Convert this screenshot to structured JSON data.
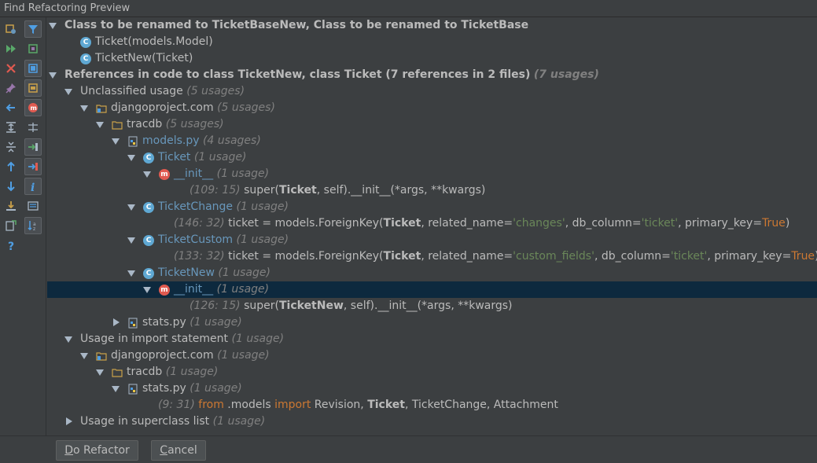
{
  "window": {
    "title": "Find Refactoring Preview"
  },
  "toolbar_left": [
    "rerun-icon",
    "run-icon",
    "close-icon",
    "pin-icon",
    "back-icon",
    "expand-all-icon",
    "collapse-all-icon",
    "up-icon",
    "down-icon",
    "export-icon",
    "open-in-new-icon",
    "help-icon"
  ],
  "toolbar_right": [
    "filter-icon",
    "settings-icon",
    "group-by-module-icon",
    "group-by-package-icon",
    "method-icon",
    "merge-icon",
    "import-icon",
    "usage-icon",
    "info-icon",
    "preview-icon",
    "sort-icon"
  ],
  "tree": {
    "header1": "Class to be renamed to TicketBaseNew, Class to be renamed to TicketBase",
    "class1": "Ticket(models.Model)",
    "class2": "TicketNew(Ticket)",
    "header2": "References in code to class TicketNew, class Ticket (7 references in 2 files)",
    "header2_count": "(7 usages)",
    "unclassified": "Unclassified usage",
    "unclassified_count": "(5 usages)",
    "project1": "djangoproject.com",
    "project1_count": "(5 usages)",
    "tracdb1": "tracdb",
    "tracdb1_count": "(5 usages)",
    "models_py": "models.py",
    "models_py_count": "(4 usages)",
    "ticket_cls": "Ticket",
    "ticket_cls_count": "(1 usage)",
    "init1": "__init__",
    "init1_count": "(1 usage)",
    "line1_pos": "(109: 15)",
    "line1_a": "super(",
    "line1_b": "Ticket",
    "line1_c": ", self).__init__(*args, **kwargs)",
    "ticketchange": "TicketChange",
    "ticketchange_count": "(1 usage)",
    "line2_pos": "(146: 32)",
    "line2_a": "ticket = models.ForeignKey(",
    "line2_b": "Ticket",
    "line2_c": ", related_name=",
    "line2_d": "'changes'",
    "line2_e": ", db_column=",
    "line2_f": "'ticket'",
    "line2_g": ", primary_key=",
    "line2_h": "True",
    "line2_i": ")",
    "ticketcustom": "TicketCustom",
    "ticketcustom_count": "(1 usage)",
    "line3_pos": "(133: 32)",
    "line3_a": "ticket = models.ForeignKey(",
    "line3_b": "Ticket",
    "line3_c": ", related_name=",
    "line3_d": "'custom_fields'",
    "line3_e": ", db_column=",
    "line3_f": "'ticket'",
    "line3_g": ", primary_key=",
    "line3_h": "True",
    "line3_i": ")",
    "ticketnew": "TicketNew",
    "ticketnew_count": "(1 usage)",
    "init2": "__init__",
    "init2_count": "(1 usage)",
    "line4_pos": "(126: 15)",
    "line4_a": "super(",
    "line4_b": "TicketNew",
    "line4_c": ", self).__init__(*args, **kwargs)",
    "stats_py1": "stats.py",
    "stats_py1_count": "(1 usage)",
    "import_usage": "Usage in import statement",
    "import_usage_count": "(1 usage)",
    "project2": "djangoproject.com",
    "project2_count": "(1 usage)",
    "tracdb2": "tracdb",
    "tracdb2_count": "(1 usage)",
    "stats_py2": "stats.py",
    "stats_py2_count": "(1 usage)",
    "line5_pos": "(9: 31)",
    "line5_a": "from",
    "line5_b": " .models ",
    "line5_c": "import",
    "line5_d": " Revision, ",
    "line5_e": "Ticket",
    "line5_f": ", TicketChange, Attachment",
    "superclass": "Usage in superclass list",
    "superclass_count": "(1 usage)"
  },
  "buttons": {
    "do_refactor_mnemonic": "D",
    "do_refactor_rest": "o Refactor",
    "cancel_mnemonic": "C",
    "cancel_rest": "ancel"
  },
  "colors": {
    "background": "#3c3f41",
    "selection": "#0d293e",
    "link": "#6897bb",
    "string": "#6a8759",
    "keyword": "#cc7832",
    "class_icon": "#5fa8d3",
    "method_icon": "#e05a50"
  }
}
